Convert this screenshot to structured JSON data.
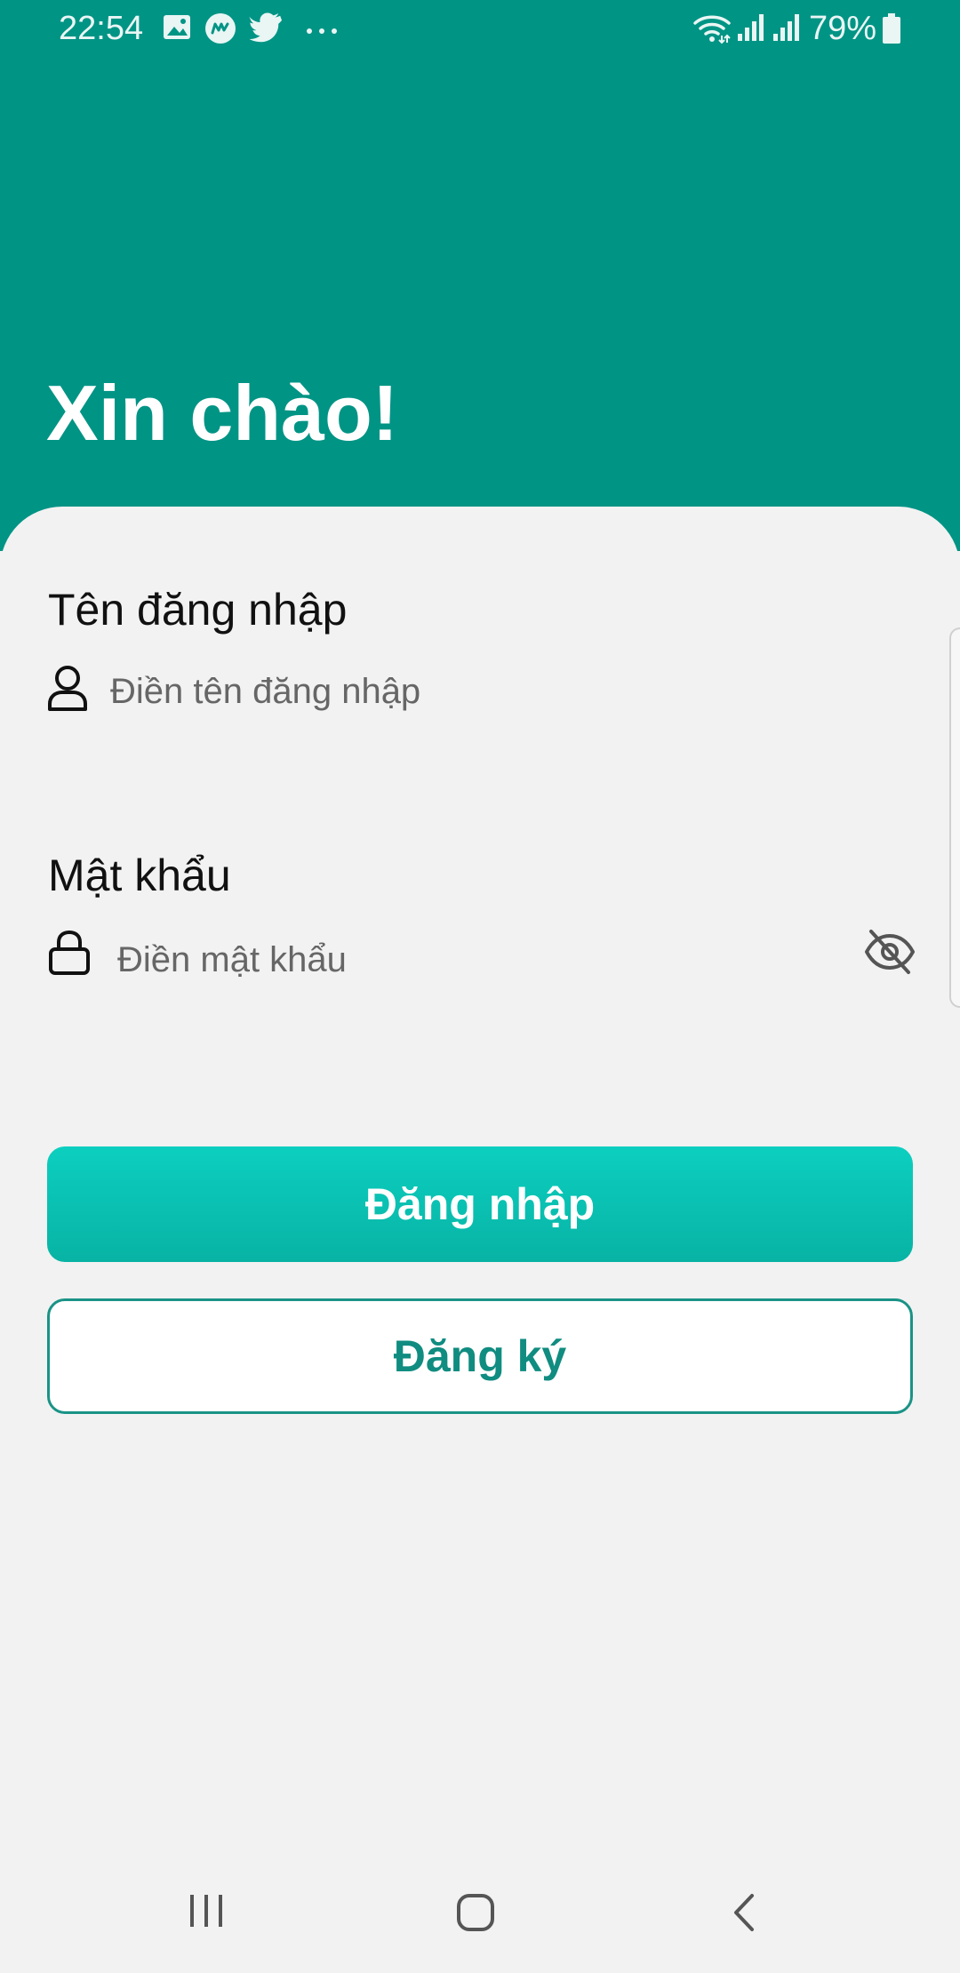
{
  "status_bar": {
    "time": "22:54",
    "battery_text": "79%",
    "icons": [
      "image-icon",
      "messenger-icon",
      "twitter-icon",
      "more-dots-icon",
      "wifi-icon",
      "signal-icon",
      "signal-icon-2",
      "battery-icon"
    ]
  },
  "header": {
    "greeting": "Xin chào!",
    "color": "#009485"
  },
  "form": {
    "username": {
      "label": "Tên đăng nhập",
      "placeholder": "Điền tên đăng nhập",
      "value": "",
      "icon": "user-icon"
    },
    "password": {
      "label": "Mật khẩu",
      "placeholder": "Điền mật khẩu",
      "value": "",
      "icon": "lock-icon",
      "toggle_icon": "eye-off-icon"
    }
  },
  "buttons": {
    "login_label": "Đăng nhập",
    "register_label": "Đăng ký",
    "accent": "#0cc4b5",
    "outline": "#1a9386"
  },
  "nav": {
    "icons": [
      "recents-icon",
      "home-icon",
      "back-icon"
    ]
  }
}
